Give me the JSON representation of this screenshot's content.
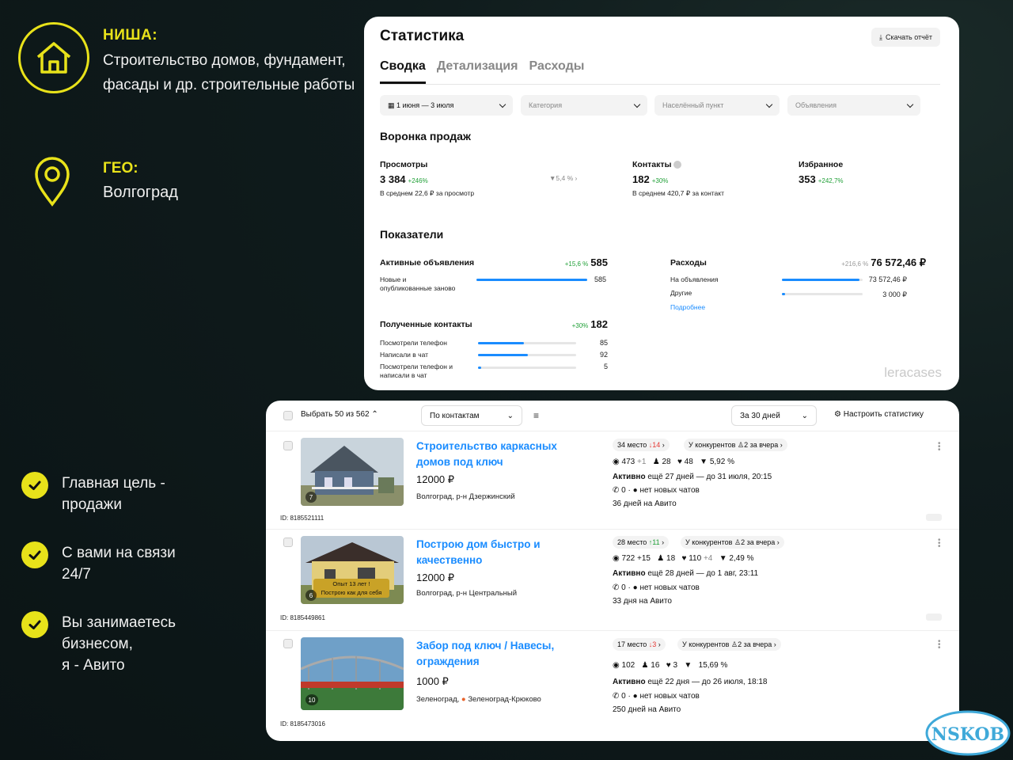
{
  "left": {
    "niche_title": "НИША:",
    "niche_line1": "Строительство домов, фундамент,",
    "niche_line2": "фасады и др. строительные работы",
    "geo_title": "ГЕО:",
    "geo_text": "Волгоград",
    "bullets": [
      {
        "line1": "Главная цель -",
        "line2": "продажи",
        "line3": ""
      },
      {
        "line1": "С вами на связи",
        "line2": "24/7",
        "line3": ""
      },
      {
        "line1": "Вы занимаетесь",
        "line2": "бизнесом,",
        "line3": "я - Авито"
      }
    ]
  },
  "stats": {
    "title": "Статистика",
    "download_label": "Скачать отчёт",
    "tabs": [
      "Сводка",
      "Детализация",
      "Расходы"
    ],
    "filters": {
      "date": "1 июня — 3 июля",
      "category": "Категория",
      "city": "Населённый пункт",
      "ads": "Объявления"
    },
    "funnel_title": "Воронка продаж",
    "views": {
      "label": "Просмотры",
      "value": "3 384",
      "delta": "+246%",
      "note": "В среднем 22,6 ₽ за просмотр",
      "conv": "5,4 %"
    },
    "contacts": {
      "label": "Контакты",
      "value": "182",
      "delta": "+30%",
      "note": "В среднем 420,7 ₽ за контакт"
    },
    "favorites": {
      "label": "Избранное",
      "value": "353",
      "delta": "+242,7%"
    },
    "indicators_title": "Показатели",
    "active": {
      "label": "Активные объявления",
      "delta": "+15,6 %",
      "value": "585",
      "sub_label": "Новые и опубликованные заново",
      "sub_value": "585",
      "fill": 1.0
    },
    "expenses": {
      "label": "Расходы",
      "delta": "+216,6 %",
      "value": "76 572,46 ₽",
      "rows": [
        {
          "label": "На объявления",
          "value": "73 572,46 ₽",
          "fill": 0.96
        },
        {
          "label": "Другие",
          "value": "3 000 ₽",
          "fill": 0.04
        }
      ],
      "more": "Подробнее"
    },
    "received": {
      "label": "Полученные контакты",
      "delta": "+30%",
      "value": "182",
      "rows": [
        {
          "label": "Посмотрели телефон",
          "value": "85",
          "fill": 0.47
        },
        {
          "label": "Написали в чат",
          "value": "92",
          "fill": 0.51
        },
        {
          "label": "Посмотрели телефон и написали в чат",
          "value": "5",
          "fill": 0.03
        }
      ]
    },
    "watermark": "leracases"
  },
  "listings": {
    "select_label": "Выбрать 50 из 562",
    "sort_label": "По контактам",
    "period_label": "За 30 дней",
    "settings_label": "Настроить статистику",
    "ads": [
      {
        "title_l1": "Строительство каркасных",
        "title_l2": "домов под ключ",
        "price": "12000 ₽",
        "location": "Волгоград, р-н Дзержинский",
        "id": "ID: 8185521111",
        "place": "34 место",
        "place_delta": "↓14",
        "competitors": "У конкурентов",
        "competitors_count": "2 за вчера",
        "views": "473",
        "views_d": "+1",
        "contacts": "28",
        "favs": "48",
        "conv": "5,92 %",
        "active": "Активно",
        "active_text": "ещё 27 дней — до 31 июля, 20:15",
        "calls": "0",
        "chats": "нет новых чатов",
        "days": "36 дней на Авито",
        "photo_count": "7",
        "caption1": "",
        "caption2": ""
      },
      {
        "title_l1": "Построю дом быстро и",
        "title_l2": "качественно",
        "price": "12000 ₽",
        "location": "Волгоград, р-н Центральный",
        "id": "ID: 8185449861",
        "place": "28 место",
        "place_delta": "↑11",
        "competitors": "У конкурентов",
        "competitors_count": "2 за вчера",
        "views": "722",
        "views_d": "+15",
        "contacts": "18",
        "favs": "110",
        "favs_d": "+4",
        "conv": "2,49 %",
        "active": "Активно",
        "active_text": "ещё 28 дней — до 1 авг, 23:11",
        "calls": "0",
        "chats": "нет новых чатов",
        "days": "33 дня на Авито",
        "photo_count": "6",
        "caption1": "Опыт 13 лет !",
        "caption2": "Построю как для себя"
      },
      {
        "title_l1": "Забор под ключ / Навесы,",
        "title_l2": "ограждения",
        "price": "1000 ₽",
        "location": "Зеленоград,",
        "location2": "Зеленоград-Крюково",
        "id": "ID: 8185473016",
        "place": "17 место",
        "place_delta": "↓3",
        "competitors": "У конкурентов",
        "competitors_count": "2 за вчера",
        "views": "102",
        "contacts": "16",
        "favs": "3",
        "conv": "15,69 %",
        "active": "Активно",
        "active_text": "ещё 22 дня — до 26 июля, 18:18",
        "calls": "0",
        "chats": "нет новых чатов",
        "days": "250 дней на Авито",
        "photo_count": "10",
        "caption1": "",
        "caption2": ""
      }
    ]
  },
  "badge": "NSKOB",
  "colors": {
    "accent": "#e8e21a",
    "link": "#1a8cff",
    "green": "#21a038",
    "red": "#e53935"
  }
}
